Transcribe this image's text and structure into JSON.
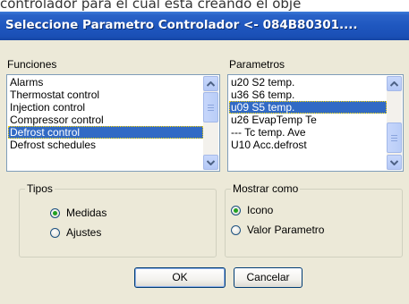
{
  "background_text": "controlador para el cual está creando el obje",
  "window": {
    "title": "Seleccione Parametro Controlador <- 084B80301...."
  },
  "funciones": {
    "label": "Funciones",
    "items": [
      {
        "label": "Alarms"
      },
      {
        "label": "Thermostat control"
      },
      {
        "label": "Injection control"
      },
      {
        "label": "Compressor control"
      },
      {
        "label": "Defrost control",
        "selected": true
      },
      {
        "label": "Defrost schedules"
      }
    ]
  },
  "parametros": {
    "label": "Parametros",
    "items": [
      {
        "label": "u20 S2 temp."
      },
      {
        "label": "u36 S6 temp."
      },
      {
        "label": "u09 S5 temp.",
        "selected": true
      },
      {
        "label": "u26 EvapTemp  Te"
      },
      {
        "label": "--- Tc temp. Ave"
      },
      {
        "label": "U10 Acc.defrost"
      }
    ]
  },
  "tipos": {
    "title": "Tipos",
    "options": [
      {
        "label": "Medidas",
        "checked": true
      },
      {
        "label": "Ajustes",
        "checked": false
      }
    ]
  },
  "mostrar_como": {
    "title": "Mostrar como",
    "options": [
      {
        "label": "Icono",
        "checked": true
      },
      {
        "label": "Valor Parametro",
        "checked": false
      }
    ]
  },
  "buttons": {
    "ok": "OK",
    "cancel": "Cancelar"
  },
  "colors": {
    "titlebar": "#1f57bf",
    "selection": "#316ac5",
    "dialog_bg": "#ece9d8"
  },
  "icons": {
    "scroll_up": "chevron-up-icon",
    "scroll_down": "chevron-down-icon"
  }
}
